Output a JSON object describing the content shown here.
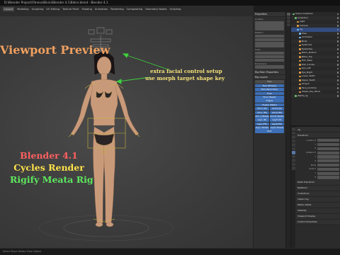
{
  "window": {
    "title": "D:\\Blender Project\\Fitness\\Bikini\\Blender 4.1\\Bikini.blend - Blender 4.1"
  },
  "menubar": {
    "items": [
      "Layout",
      "Modeling",
      "Sculpting",
      "UV Editing",
      "Texture Paint",
      "Shading",
      "Animation",
      "Rendering",
      "Compositing",
      "Geometry Nodes",
      "Scripting"
    ],
    "active_index": 0
  },
  "viewport": {
    "title": "Viewport Preview",
    "annotation_line1": "extra facial control setup",
    "annotation_line2": "use morph target shape key",
    "render_info": [
      "Blender 4.1",
      "Cycles Render",
      "Rigify Meata Rig"
    ],
    "colors": {
      "title": "#f0a060",
      "annotation": "#f5e27a",
      "arrow": "#3fd13f",
      "render_line1": "#ff6060",
      "render_line2": "#ffe24a",
      "render_line3": "#5de85d"
    }
  },
  "npanel": {
    "header": "Properties",
    "sections": [
      "Location",
      "Rotation",
      "Scale",
      "Dimensions"
    ],
    "rig_label": "Rig Main Properties",
    "rig_layers_label": "Rig Layers",
    "rig_buttons": [
      "Face",
      "Face (Primary)",
      "Face (Secondary)",
      "Torso",
      "Torso (Tweak)",
      "Fingers",
      "Fingers (Detail)",
      "Arm.L (IK)",
      "Arm.R (IK)",
      "Arm.L (FK)",
      "Arm.R (FK)",
      "Arm.L (Tweak)",
      "Arm.R (Tweak)",
      "Leg.L (IK)",
      "Leg.R (IK)",
      "Leg.L (FK)",
      "Leg.R (FK)",
      "Leg.L (Tweak)",
      "Leg.R (Tweak)",
      "Root"
    ]
  },
  "outliner": {
    "rows": [
      {
        "label": "Scene Collection",
        "icon": "collection-icon",
        "indent": 0,
        "selected": false
      },
      {
        "label": "Collection",
        "icon": "collection-icon",
        "indent": 1,
        "selected": false
      },
      {
        "label": "Light",
        "icon": "light-icon",
        "indent": 2,
        "selected": false
      },
      {
        "label": "Camera",
        "icon": "camera-icon",
        "indent": 2,
        "selected": false
      },
      {
        "label": "rig",
        "icon": "armature-icon",
        "indent": 2,
        "selected": true
      },
      {
        "label": "Pose",
        "icon": "bone-icon",
        "indent": 3,
        "selected": false
      },
      {
        "label": "Animation",
        "icon": "bone-icon",
        "indent": 3,
        "selected": false
      },
      {
        "label": "Body",
        "icon": "mesh-icon",
        "indent": 3,
        "selected": false
      },
      {
        "label": "Eyebrows",
        "icon": "mesh-icon",
        "indent": 3,
        "selected": false
      },
      {
        "label": "Eyelashes",
        "icon": "mesh-icon",
        "indent": 3,
        "selected": false
      },
      {
        "label": "Bikini_Bottom",
        "icon": "mesh-icon",
        "indent": 3,
        "selected": false
      },
      {
        "label": "Bikini_Top",
        "icon": "mesh-icon",
        "indent": 3,
        "selected": false
      },
      {
        "label": "Hair_Base",
        "icon": "mesh-icon",
        "indent": 3,
        "selected": false
      },
      {
        "label": "Hair_Curves",
        "icon": "mesh-icon",
        "indent": 3,
        "selected": false
      },
      {
        "label": "Eye_Left",
        "icon": "mesh-icon",
        "indent": 3,
        "selected": false
      },
      {
        "label": "Eye_Right",
        "icon": "mesh-icon",
        "indent": 3,
        "selected": false
      },
      {
        "label": "Lower_Teeth",
        "icon": "mesh-icon",
        "indent": 3,
        "selected": false
      },
      {
        "label": "Upper_Teeth",
        "icon": "mesh-icon",
        "indent": 3,
        "selected": false
      },
      {
        "label": "Tongue",
        "icon": "mesh-icon",
        "indent": 3,
        "selected": false
      },
      {
        "label": "Face_Controls",
        "icon": "mesh-icon",
        "indent": 3,
        "selected": false
      },
      {
        "label": "Shape_Key_Panel",
        "icon": "mesh-icon",
        "indent": 3,
        "selected": false
      },
      {
        "label": "WGTS_rig",
        "icon": "collection-icon",
        "indent": 1,
        "selected": false
      }
    ]
  },
  "properties": {
    "object_name": "rig",
    "sections": [
      "Transform",
      "Delta Transform",
      "Relations",
      "Collections",
      "Instancing",
      "Motion Paths",
      "Visibility",
      "Viewport Display",
      "Custom Properties"
    ],
    "transform_rows": [
      "Location X",
      "Y",
      "Z",
      "Rotation X",
      "Y",
      "Z",
      "Mode",
      "Scale X",
      "Y",
      "Z"
    ]
  },
  "statusbar": {
    "text": "Select    Move    Rotate View    Object"
  }
}
